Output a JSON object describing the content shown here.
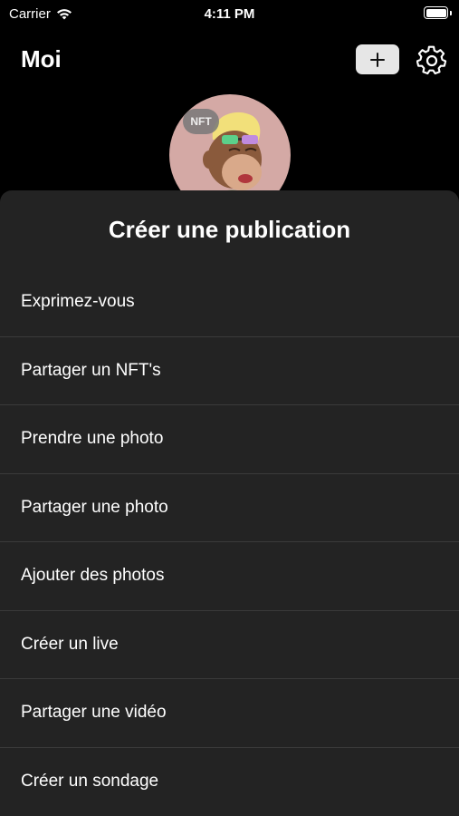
{
  "status_bar": {
    "carrier": "Carrier",
    "time": "4:11 PM",
    "wifi_icon": "wifi-icon",
    "battery_icon": "battery-icon"
  },
  "header": {
    "title": "Moi",
    "add_icon": "plus-icon",
    "settings_icon": "gear-icon"
  },
  "profile": {
    "nft_badge": "NFT",
    "avatar_background": "#d4a9a5"
  },
  "sheet": {
    "title": "Créer une publication",
    "items": [
      {
        "label": "Exprimez-vous"
      },
      {
        "label": "Partager un NFT's"
      },
      {
        "label": "Prendre une photo"
      },
      {
        "label": "Partager une photo"
      },
      {
        "label": "Ajouter des photos"
      },
      {
        "label": "Créer un live"
      },
      {
        "label": "Partager une vidéo"
      },
      {
        "label": "Créer un sondage"
      }
    ]
  },
  "colors": {
    "background": "#000000",
    "sheet": "#232323",
    "separator": "#3a3a3a",
    "text": "#ffffff",
    "add_button": "#e6e6e6"
  }
}
